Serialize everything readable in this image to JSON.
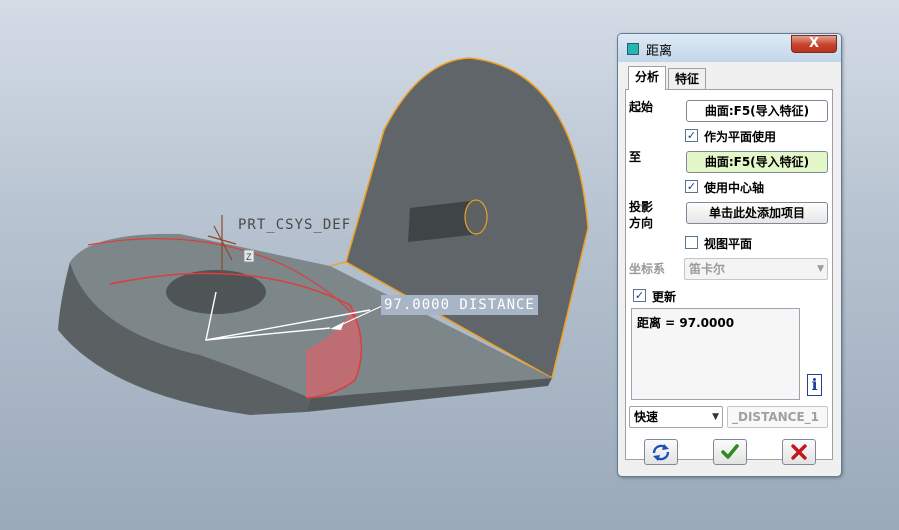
{
  "viewport": {
    "csys_label": "PRT_CSYS_DEF",
    "csys_axis": "Z",
    "distance_label": "97.0000  DISTANCE"
  },
  "dialog": {
    "title": "距离",
    "close_label": "X",
    "tabs": [
      "分析",
      "特征"
    ],
    "from_label": "起始",
    "from_value": "曲面:F5(导入特征)",
    "use_as_plane_label": "作为平面使用",
    "to_label": "至",
    "to_value": "曲面:F5(导入特征)",
    "use_center_axis_label": "使用中心轴",
    "projection_label_line1": "投影",
    "projection_label_line2": "方向",
    "projection_button": "单击此处添加项目",
    "view_plane_label": "视图平面",
    "csys_label": "坐标系",
    "csys_value": "笛卡尔",
    "update_label": "更新",
    "result_text": "距离 = 97.0000",
    "mode_value": "快速",
    "name_value": "_DISTANCE_1"
  },
  "colors": {
    "accent_ok": "#2e8b1e",
    "accent_cancel": "#c4161c",
    "collector_active": "#e4f7c8",
    "model_edge": "#f0a020",
    "measure_red": "#e03c3c"
  }
}
